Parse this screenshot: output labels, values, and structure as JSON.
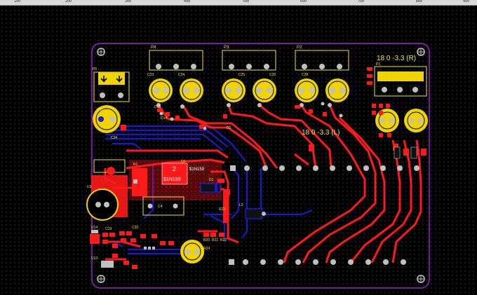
{
  "ruler": {
    "ticks": [
      "100",
      "200",
      "300",
      "400",
      "500",
      "600",
      "700",
      "800",
      "900"
    ]
  },
  "connectors": {
    "p4": "P4",
    "p3": "P3",
    "p2": "P2",
    "p1": "P1",
    "p5": "P5"
  },
  "rails": {
    "right_top": "18  0  -3.3  (R)",
    "right_mid": "18  0  -3.3  (L)"
  },
  "components": {
    "u1": "U1",
    "u3": "U3",
    "u14": "U14",
    "u13": "U13",
    "c4": "C4",
    "c19": "C19",
    "c20": "C20",
    "c34": "C34",
    "c23": "C23",
    "c24": "C24",
    "c25": "C25",
    "c26": "C26",
    "c27": "C27",
    "c28": "C28",
    "c31": "C31",
    "q1": "Q1",
    "r1": "R1",
    "r20": "R20",
    "r21": "R21",
    "r22": "R22",
    "r23": "R23",
    "r24": "R24",
    "l3": "L3",
    "d1": "D1",
    "d2": "D2",
    "d13": "D13",
    "d14": "D14"
  },
  "selection": {
    "number": "2",
    "part": "$1N159",
    "part_tag": "$1N159"
  },
  "colors": {
    "board_outline": "#a020d0",
    "top_copper": "#ff1a1a",
    "bottom_copper": "#1a1acc",
    "silkscreen": "#f0e14a",
    "background": "#000000"
  }
}
